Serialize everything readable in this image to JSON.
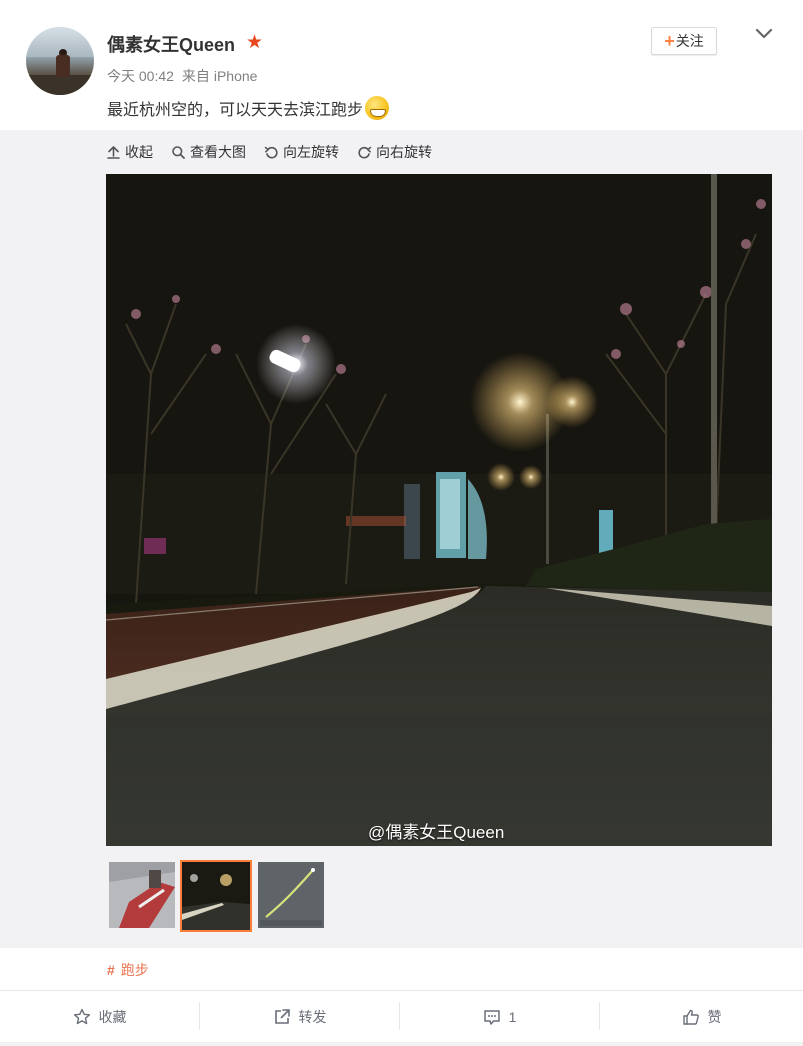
{
  "post": {
    "username": "偶素女王Queen",
    "time": "今天 00:42",
    "source_prefix": "来自",
    "source": "iPhone",
    "text": "最近杭州空的，可以天天去滨江跑步",
    "follow_label": "关注",
    "emoji_icon": "grin-emoji-icon"
  },
  "toolbar": {
    "collapse": "收起",
    "view_large": "查看大图",
    "rotate_left": "向左旋转",
    "rotate_right": "向右旋转"
  },
  "photo": {
    "watermark": "@偶素女王Queen",
    "thumb_count": 3,
    "active_thumb": 2
  },
  "topic": {
    "hash": "#",
    "label": "跑步"
  },
  "actions": {
    "favorite": "收藏",
    "repost": "转发",
    "comment": "1",
    "like": "赞"
  },
  "colors": {
    "accent": "#fa7d3c",
    "tag": "#eb7350",
    "panel_bg": "#f2f2f5"
  }
}
